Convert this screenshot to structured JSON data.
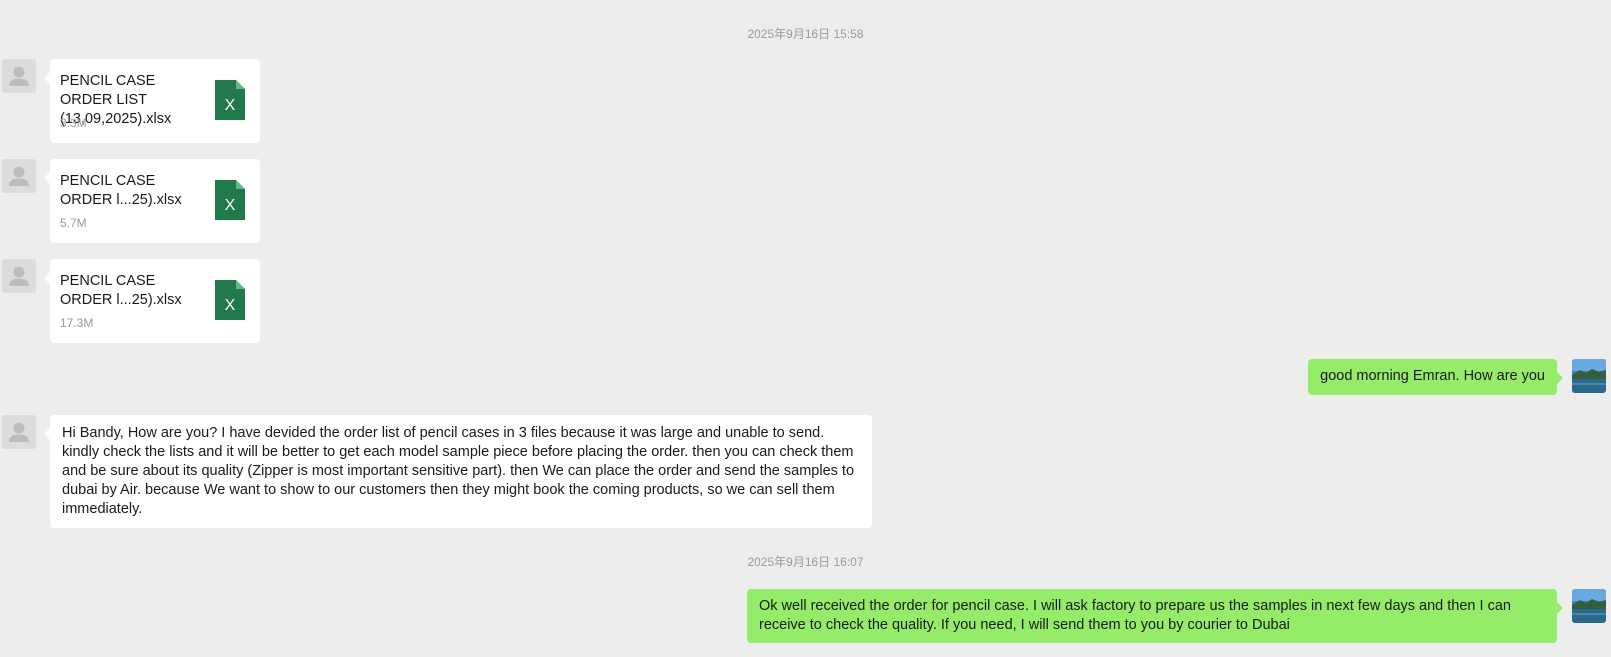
{
  "chat": {
    "timestamps": [
      "2025年9月16日 15:58",
      "2025年9月16日 16:07"
    ],
    "file_messages": [
      {
        "name": "PENCIL CASE ORDER LIST (13,09,2025).xlsx",
        "size": "3.3M",
        "icon": "excel-file-icon",
        "icon_letter": "X"
      },
      {
        "name": "PENCIL CASE ORDER l...25).xlsx",
        "size": "5.7M",
        "icon": "excel-file-icon",
        "icon_letter": "X"
      },
      {
        "name": "PENCIL CASE ORDER l...25).xlsx",
        "size": "17.3M",
        "icon": "excel-file-icon",
        "icon_letter": "X"
      }
    ],
    "messages": [
      {
        "direction": "outgoing",
        "text": "good morning Emran. How are you"
      },
      {
        "direction": "incoming",
        "text": "Hi Bandy, How are you? I have devided the order list of pencil cases in 3 files because it was large and unable to send. kindly check the lists and it will be better to get each model sample piece before placing the order. then you can check them and be sure about its quality (Zipper is most important sensitive part). then We can place the order and send the samples to dubai by Air. because We want to show to our customers then they might book the coming products, so we can sell them immediately."
      },
      {
        "direction": "outgoing",
        "text": "Ok well received the order for pencil case. I will ask factory to prepare us the samples in next few days and then I can receive to check the quality. If you need, I will send them to you by courier to Dubai"
      }
    ]
  },
  "colors": {
    "background": "#ededed",
    "incoming_bubble": "#ffffff",
    "outgoing_bubble": "#95ec69",
    "excel_green": "#21784a"
  }
}
